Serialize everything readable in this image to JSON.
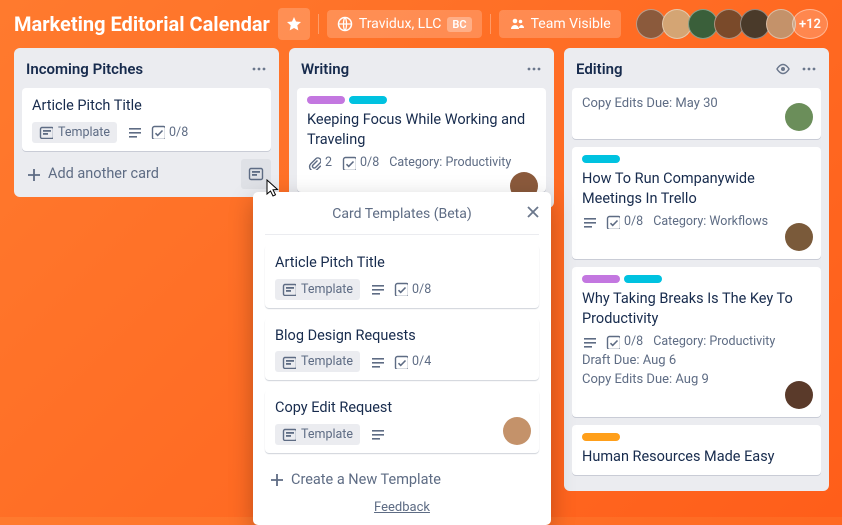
{
  "colors": {
    "purple": "#c377e0",
    "teal": "#00c2e0",
    "orange": "#ff9f1a"
  },
  "header": {
    "board_title": "Marketing Editorial Calendar",
    "org_name": "Travidux, LLC",
    "org_badge": "BC",
    "team_visible": "Team Visible",
    "avatar_overflow": "+12"
  },
  "lists": [
    {
      "title": "Incoming Pitches",
      "add_card": "Add another card",
      "cards": [
        {
          "title": "Article Pitch Title",
          "template_label": "Template",
          "checklist": "0/8"
        }
      ]
    },
    {
      "title": "Writing",
      "cards": [
        {
          "title": "Keeping Focus While Working and Traveling",
          "attachments": "2",
          "checklist": "0/8",
          "category": "Category: Productivity"
        }
      ]
    },
    {
      "title": "Editing",
      "cards": [
        {
          "copy_due": "Copy Edits Due: May 30"
        },
        {
          "title": "How To Run Companywide Meetings In Trello",
          "checklist": "0/8",
          "category": "Category: Workflows"
        },
        {
          "title": "Why Taking Breaks Is The Key To Productivity",
          "checklist": "0/8",
          "category": "Category: Productivity",
          "draft_due": "Draft Due: Aug 6",
          "copy_due": "Copy Edits Due: Aug 9"
        },
        {
          "title": "Human Resources Made Easy"
        }
      ]
    }
  ],
  "popover": {
    "title": "Card Templates (Beta)",
    "new_template": "Create a New Template",
    "feedback": "Feedback",
    "templates": [
      {
        "title": "Article Pitch Title",
        "template_label": "Template",
        "checklist": "0/8"
      },
      {
        "title": "Blog Design Requests",
        "template_label": "Template",
        "checklist": "0/4"
      },
      {
        "title": "Copy Edit Request",
        "template_label": "Template"
      }
    ]
  }
}
